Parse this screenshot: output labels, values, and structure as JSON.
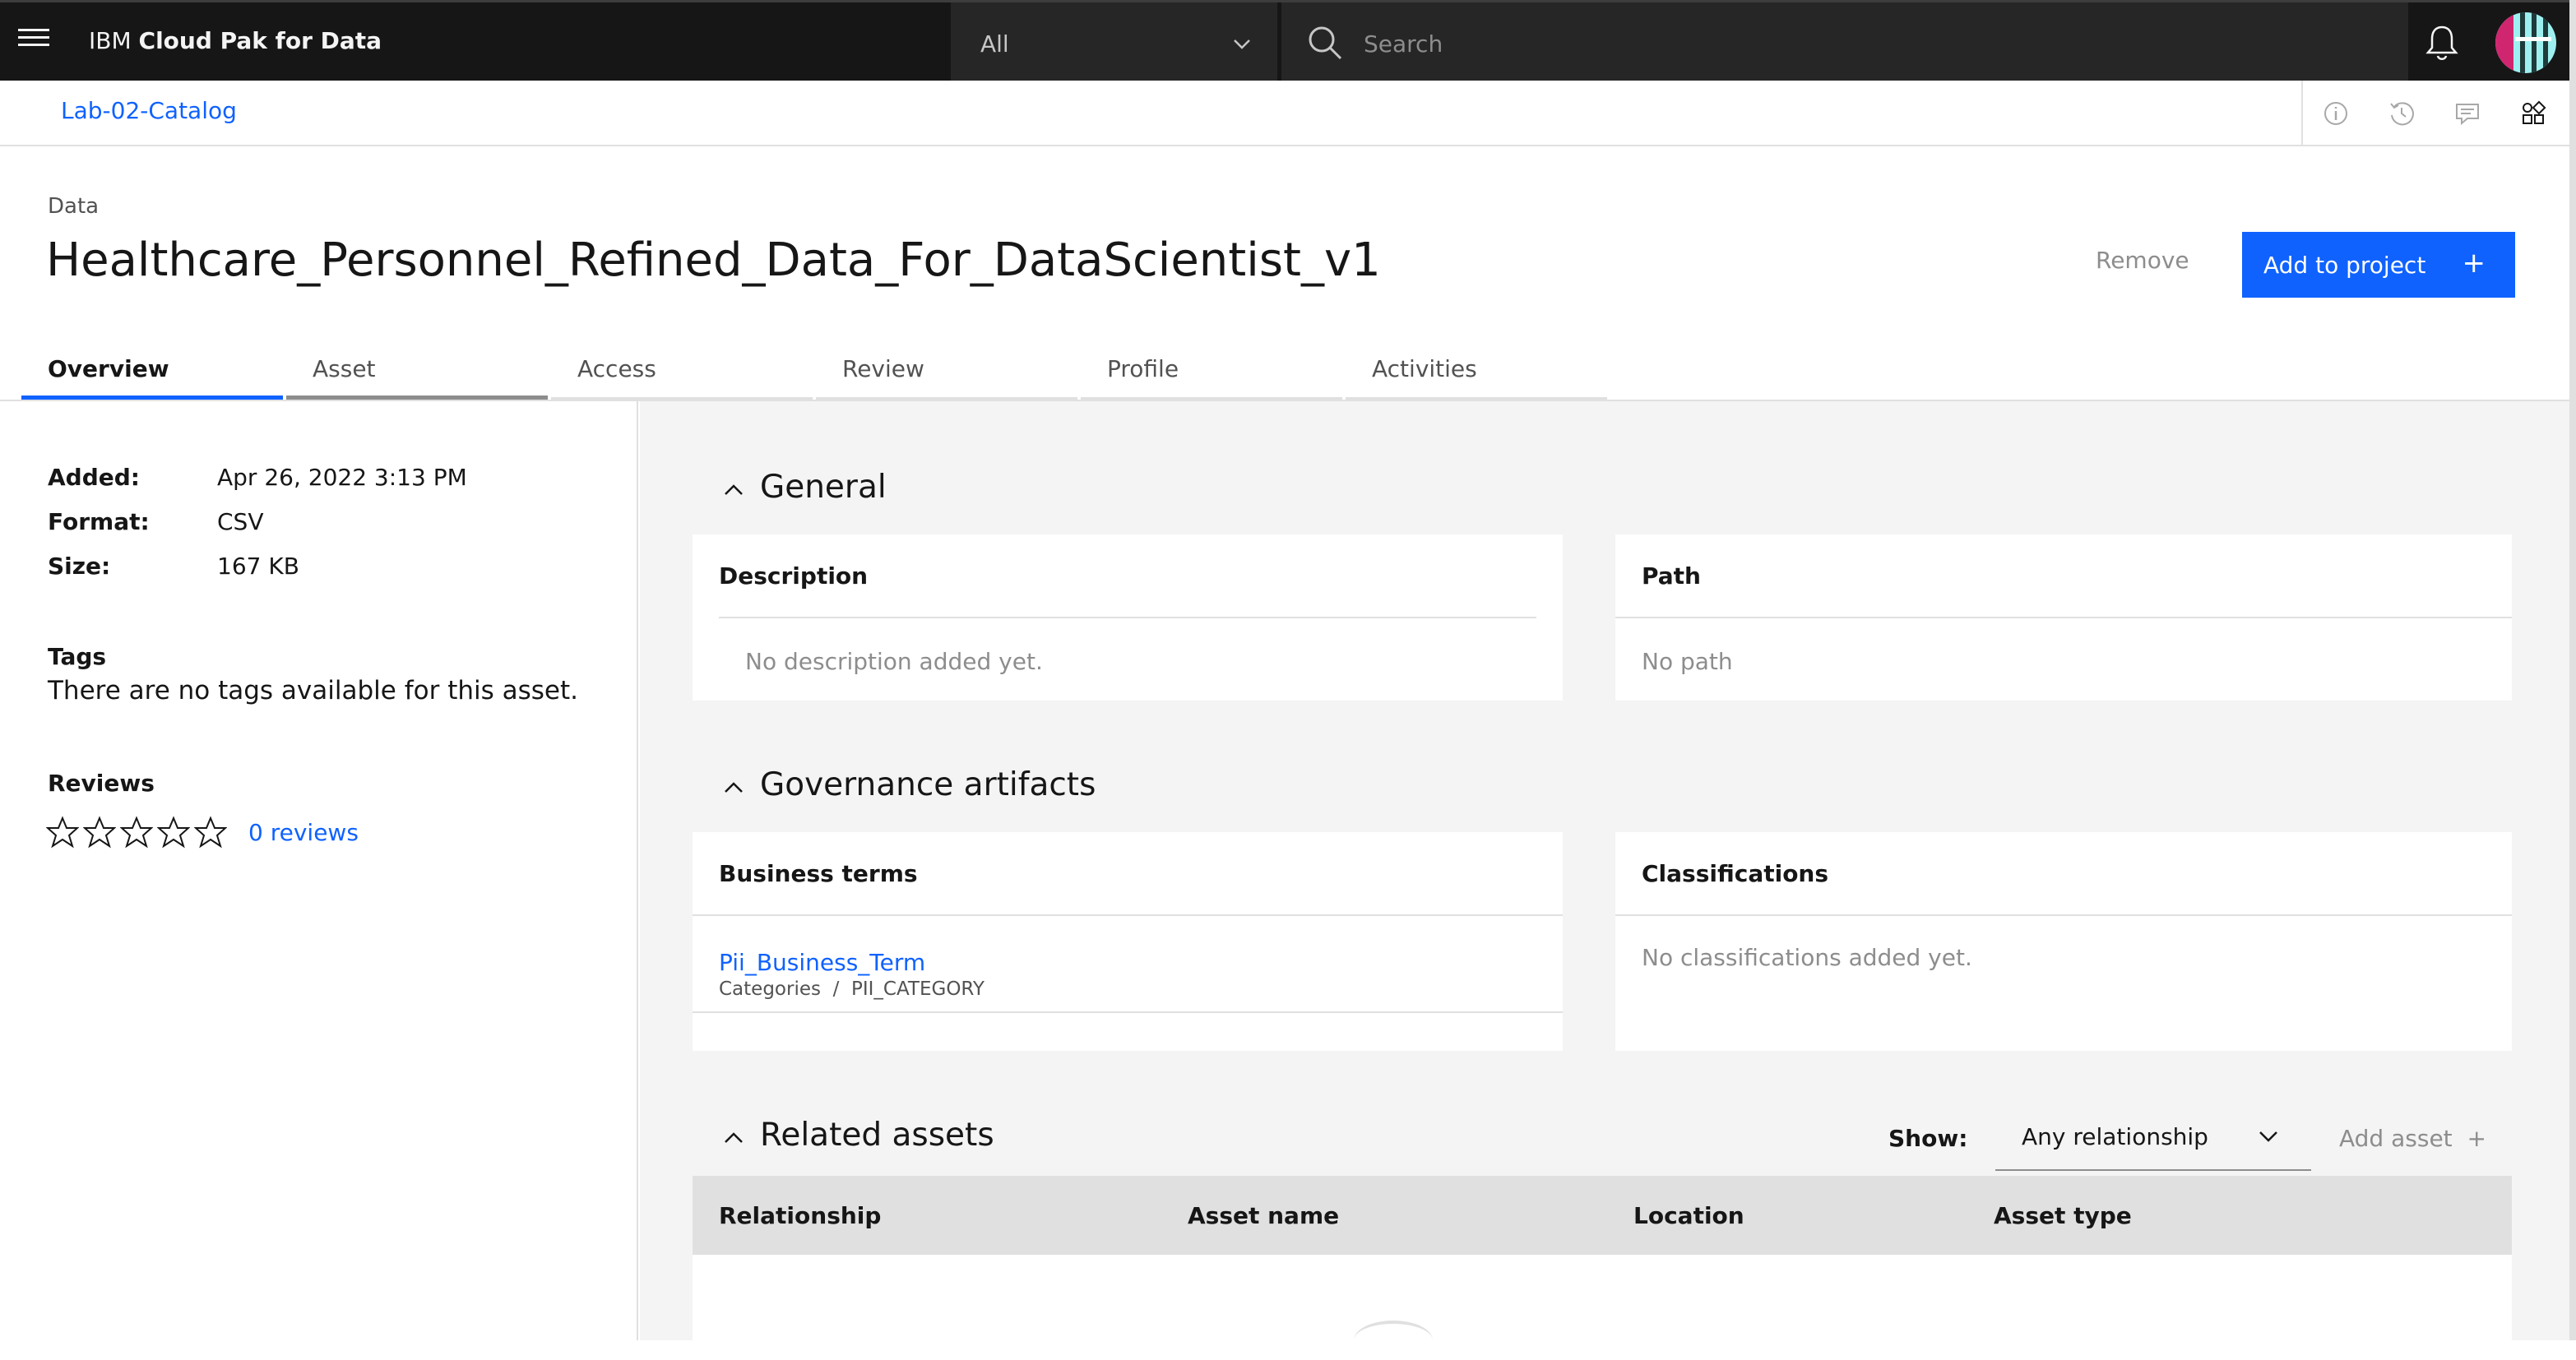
{
  "header": {
    "brand_prefix": "IBM",
    "brand_name": "Cloud Pak for Data",
    "scope_selected": "All",
    "search_placeholder": "Search"
  },
  "breadcrumb": {
    "catalog": "Lab-02-Catalog"
  },
  "asset": {
    "eyebrow": "Data",
    "title": "Healthcare_Personnel_Refined_Data_For_DataScientist_v1",
    "remove_label": "Remove",
    "add_to_project_label": "Add to project",
    "add_icon": "+"
  },
  "tabs": [
    {
      "label": "Overview"
    },
    {
      "label": "Asset"
    },
    {
      "label": "Access"
    },
    {
      "label": "Review"
    },
    {
      "label": "Profile"
    },
    {
      "label": "Activities"
    }
  ],
  "overview": {
    "meta": [
      {
        "key": "Added:",
        "value": "Apr 26, 2022 3:13 PM"
      },
      {
        "key": "Format:",
        "value": "CSV"
      },
      {
        "key": "Size:",
        "value": "167 KB"
      }
    ],
    "tags_heading": "Tags",
    "tags_empty": "There are no tags available for this asset.",
    "reviews_heading": "Reviews",
    "rating": 0,
    "reviews_link": "0 reviews"
  },
  "general": {
    "heading": "General",
    "description_heading": "Description",
    "description_empty": "No description added yet.",
    "path_heading": "Path",
    "path_empty": "No path"
  },
  "governance": {
    "heading": "Governance artifacts",
    "terms_heading": "Business terms",
    "term_name": "Pii_Business_Term",
    "term_path": "Categories  /  PII_CATEGORY",
    "classifications_heading": "Classifications",
    "classifications_empty": "No classifications added yet."
  },
  "related": {
    "heading": "Related assets",
    "show_label": "Show:",
    "relationship_filter": "Any relationship",
    "add_asset_label": "Add asset  +",
    "columns": [
      "Relationship",
      "Asset name",
      "Location",
      "Asset type"
    ]
  },
  "colors": {
    "accent": "#0f62fe",
    "header_bg": "#161616",
    "panel_bg": "#f4f4f4"
  },
  "icons": [
    "menu-icon",
    "chevron-down-icon",
    "search-icon",
    "notification-icon",
    "avatar",
    "info-icon",
    "history-icon",
    "comment-icon",
    "apps-icon",
    "star-icon",
    "chevron-up-icon"
  ]
}
